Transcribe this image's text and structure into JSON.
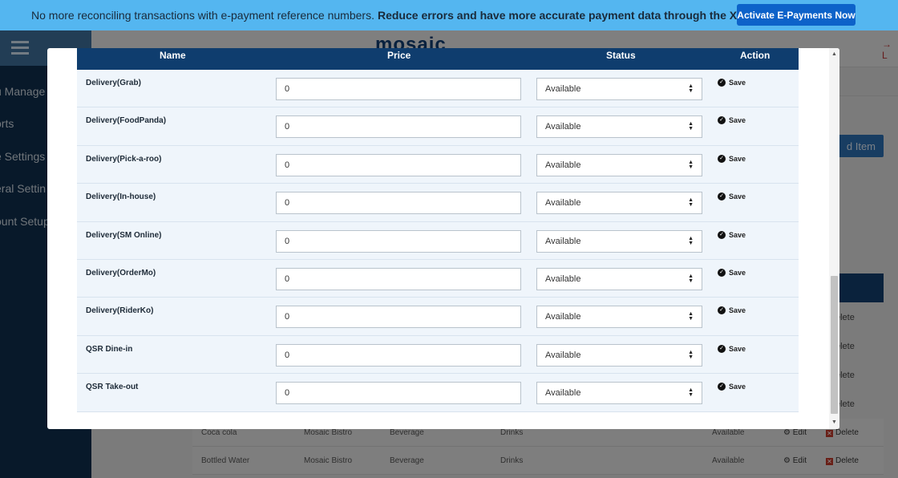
{
  "banner": {
    "text": "No more reconciling transactions with e-payment reference numbers.",
    "bold_text": "Reduce errors and have more accurate payment data through the Xendit integration.",
    "cta_label": "Activate E-Payments Now",
    "bg_color": "#54b6f0",
    "cta_color": "#0d62c9"
  },
  "app": {
    "logo": "mosaic",
    "sidebar_items": [
      "u Manage",
      "orts",
      "e Settings",
      "eral Settin",
      "ount Setup"
    ],
    "add_item_label": "d Item",
    "bg_row_delete_label": "elete",
    "bg_rows": [
      {
        "name": "Coca cola",
        "branch": "Mosaic Bistro",
        "category": "Beverage",
        "subcategory": "Drinks",
        "status": "Available",
        "edit": "Edit",
        "delete": "Delete"
      },
      {
        "name": "Bottled Water",
        "branch": "Mosaic Bistro",
        "category": "Beverage",
        "subcategory": "Drinks",
        "status": "Available",
        "edit": "Edit",
        "delete": "Delete"
      }
    ]
  },
  "modal": {
    "columns": {
      "name": "Name",
      "price": "Price",
      "status": "Status",
      "action": "Action"
    },
    "header_color": "#0f3d6e",
    "rows": [
      {
        "name": "Delivery(Grab)",
        "price": "0",
        "status": "Available",
        "action": "Save"
      },
      {
        "name": "Delivery(FoodPanda)",
        "price": "0",
        "status": "Available",
        "action": "Save"
      },
      {
        "name": "Delivery(Pick-a-roo)",
        "price": "0",
        "status": "Available",
        "action": "Save"
      },
      {
        "name": "Delivery(In-house)",
        "price": "0",
        "status": "Available",
        "action": "Save"
      },
      {
        "name": "Delivery(SM Online)",
        "price": "0",
        "status": "Available",
        "action": "Save"
      },
      {
        "name": "Delivery(OrderMo)",
        "price": "0",
        "status": "Available",
        "action": "Save"
      },
      {
        "name": "Delivery(RiderKo)",
        "price": "0",
        "status": "Available",
        "action": "Save"
      },
      {
        "name": "QSR Dine-in",
        "price": "0",
        "status": "Available",
        "action": "Save"
      },
      {
        "name": "QSR Take-out",
        "price": "0",
        "status": "Available",
        "action": "Save"
      }
    ]
  }
}
